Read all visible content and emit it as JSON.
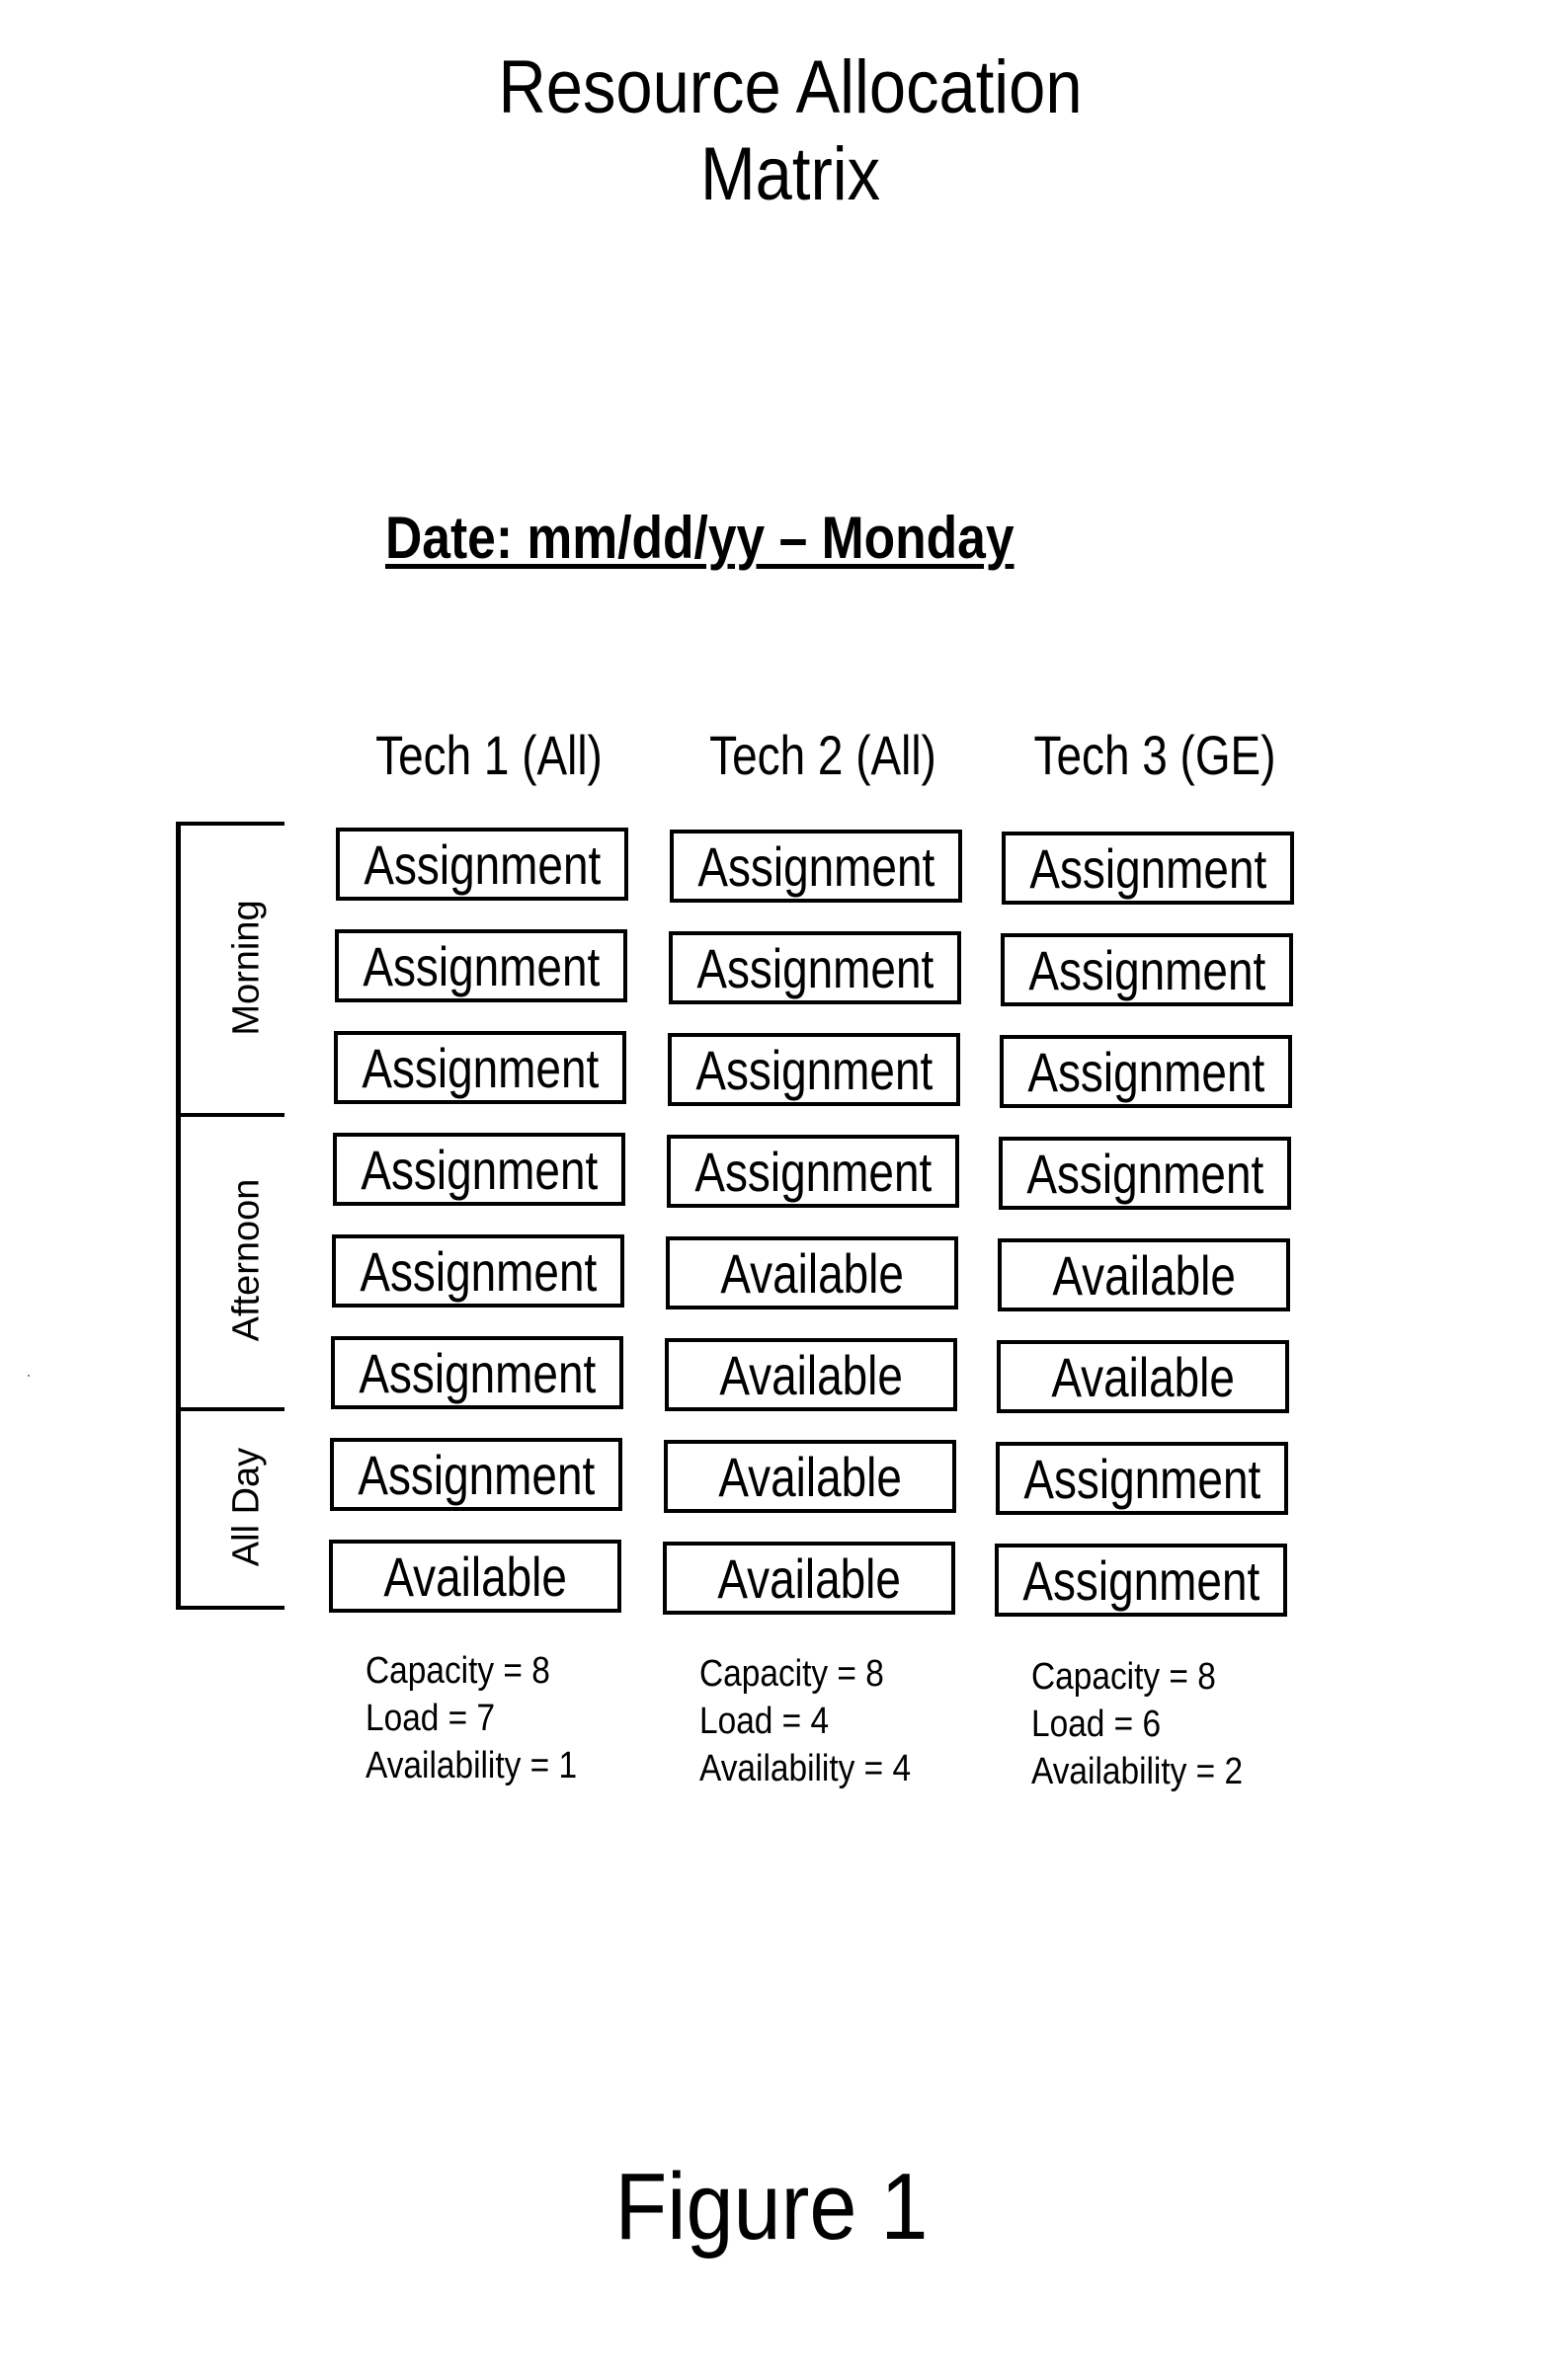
{
  "title": {
    "line1": "Resource Allocation",
    "line2": "Matrix"
  },
  "date_heading": "Date: mm/dd/yy – Monday",
  "periods": [
    {
      "label": "Morning",
      "rows": 3
    },
    {
      "label": "Afternoon",
      "rows": 3
    },
    {
      "label": "All Day",
      "rows": 2
    }
  ],
  "techs": [
    {
      "header": "Tech 1 (All)",
      "slots": [
        "Assignment",
        "Assignment",
        "Assignment",
        "Assignment",
        "Assignment",
        "Assignment",
        "Assignment",
        "Available"
      ],
      "stats": {
        "capacity": "Capacity = 8",
        "load": "Load = 7",
        "availability": "Availability = 1"
      }
    },
    {
      "header": "Tech 2 (All)",
      "slots": [
        "Assignment",
        "Assignment",
        "Assignment",
        "Assignment",
        "Available",
        "Available",
        "Available",
        "Available"
      ],
      "stats": {
        "capacity": "Capacity = 8",
        "load": "Load = 4",
        "availability": "Availability = 4"
      }
    },
    {
      "header": "Tech 3 (GE)",
      "slots": [
        "Assignment",
        "Assignment",
        "Assignment",
        "Assignment",
        "Available",
        "Available",
        "Assignment",
        "Assignment"
      ],
      "stats": {
        "capacity": "Capacity = 8",
        "load": "Load = 6",
        "availability": "Availability = 2"
      }
    }
  ],
  "figure_label": "Figure 1"
}
